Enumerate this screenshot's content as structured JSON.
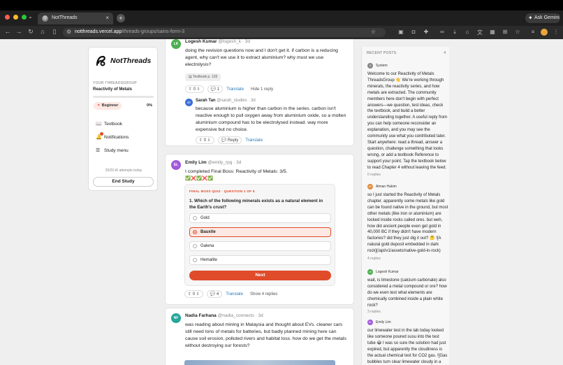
{
  "browser": {
    "tab_title": "NotThreads",
    "url_host": "notthreads.vercel.app",
    "url_path": "/threads-groups/sains-form-3",
    "ask_gemini": "Ask Gemini"
  },
  "sidebar": {
    "logo_text": "NotThreads",
    "group_label": "YOUR THREADSGROUP",
    "group_name": "Reactivity of Metals",
    "progress_fraction": 0.0,
    "level_badge": "Beginner",
    "level_pct": "0%",
    "nav": [
      {
        "label": "Textbook",
        "icon": "book-icon"
      },
      {
        "label": "Notifications",
        "icon": "bell-icon"
      },
      {
        "label": "Study menu",
        "icon": "menu-icon"
      }
    ],
    "attempts": "20/20 AI attempts today",
    "end_study": "End Study"
  },
  "feed": {
    "post1": {
      "avatar": "LK",
      "name": "Logesh Kumar",
      "meta": "@logesh_k · 3d",
      "text": "doing the revision questions now and I don't get it. if carbon is a reducing agent, why can't we use it to extract aluminium? why must we use electrolysis?",
      "chip": "Textbook p. 133",
      "up": "0",
      "comments": "1",
      "translate": "Translate",
      "hide": "Hide 1 reply",
      "reply": {
        "avatar": "ST",
        "name": "Sarah Tan",
        "meta": "@sarah_studies · 3d",
        "text": "because aluminium is higher than carbon in the series. carbon isn't reactive enough to pull oxygen away from aluminium oxide, so a molten aluminium compound has to be electrolysed instead. way more expensive but no choice.",
        "up": "0",
        "reply_label": "Reply",
        "translate": "Translate"
      }
    },
    "post2": {
      "avatar": "EL",
      "name": "Emily Lim",
      "meta": "@emily_rpg · 3d",
      "text": "I completed Final Boss: Reactivity of Metals: 3/5.",
      "marks": "✅❌✅❌✅",
      "quiz": {
        "label": "FINAL BOSS QUIZ · QUESTION 1 OF 5",
        "question": "1. Which of the following minerals exists as a natural element in the Earth's crust?",
        "options": [
          "Gold",
          "Bauxite",
          "Galena",
          "Hematite"
        ],
        "selected": "Bauxite",
        "next": "Next"
      },
      "up": "0",
      "comments": "4",
      "translate": "Translate",
      "show": "Show 4 replies"
    },
    "post3": {
      "avatar": "NF",
      "name": "Nadia Farhana",
      "meta": "@nadia_connects · 3d",
      "text": "was reading about mining in Malaysia and thought about EVs. cleaner cars still need tons of metals for batteries, but badly planned mining here can cause soil erosion, polluted rivers and habitat loss. how do we get the metals without destroying our forests?"
    }
  },
  "recent": {
    "title": "RECENT POSTS",
    "count": "4",
    "posts": [
      {
        "avatar": "S",
        "name": "System",
        "text": "Welcome to our Reactivity of Metals ThreadsGroup 👋 We're working through minerals, the reactivity series, and how metals are extracted. The community members here don't begin with perfect answers—we question, test ideas, check the textbook, and build a better understanding together. A useful reply from you can help someone reconsider an explanation, and you may see the community use what you contributed later. Start anywhere: read a thread, answer a question, challenge something that looks wrong, or add a textbook Reference to support your point. Tap the textbook below to read Chapter 4 without leaving the feed.",
        "replies": "0 replies"
      },
      {
        "avatar": "AH",
        "name": "Aiman Hakim",
        "text": "so I just started the Reactivity of Metals chapter. apparently some metals like gold can be found native in the ground, but most other metals (like iron or aluminium) are locked inside rocks called ores. but weh, how did ancient people even get gold in 40,000 BC if they didn't have modern factories? did they just dig it out? 🤔 ![A natural gold deposit embedded in dark rock](/api/v1/assets/native-gold-in-rock)",
        "replies": "4 replies"
      },
      {
        "avatar": "LK",
        "name": "Logesh Kumar",
        "text": "wait, is limestone (calcium carbonate) also considered a metal compound or ore? how do we even test what elements are chemically combined inside a plain white rock?",
        "replies": "3 replies"
      },
      {
        "avatar": "EL",
        "name": "Emily Lim",
        "text": "our limewater test in the lab today looked like someone poured susu into the test tube 😂 I was so sure the solution had just expired, but apparently the cloudiness is the actual chemical test for CO2 gas. ![Gas bubbles turn clear limewater cloudy in a test tube]",
        "replies": ""
      }
    ]
  }
}
